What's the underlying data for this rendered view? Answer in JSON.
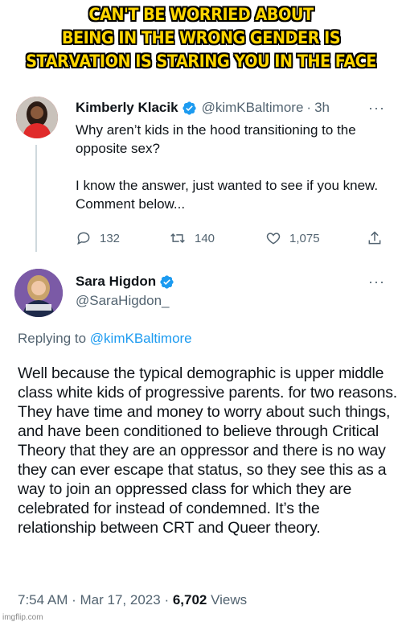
{
  "caption": {
    "line1": "CAN'T BE WORRIED ABOUT",
    "line2": "BEING IN THE WRONG GENDER IS",
    "line3": "STARVATION IS STARING YOU IN THE FACE"
  },
  "tweet1": {
    "name": "Kimberly Klacik",
    "handle": "@kimKBaltimore",
    "separator": "·",
    "time": "3h",
    "more": "···",
    "text": "Why aren’t kids in the hood transitioning to the opposite sex?\n\nI know the answer, just wanted to see if you knew. Comment below...",
    "actions": {
      "reply_count": "132",
      "retweet_count": "140",
      "like_count": "1,075"
    },
    "icons": [
      "reply-icon",
      "retweet-icon",
      "like-icon",
      "share-icon"
    ]
  },
  "tweet2": {
    "name": "Sara Higdon",
    "handle": "@SaraHigdon_",
    "more": "···",
    "replying_prefix": "Replying to",
    "replying_to": "@kimKBaltimore",
    "text": "Well because the typical demographic is upper middle class white kids of progressive parents. for two reasons. They have time and money to worry about such things, and have been conditioned to believe through Critical Theory that they are an oppressor and there is no way they can ever escape that status, so they see this as a way to join an oppressed class for which they are celebrated for instead of condemned. It’s the relationship between CRT and Queer theory.",
    "time": "7:54 AM",
    "dot1": "·",
    "date": "Mar 17, 2023",
    "dot2": "·",
    "views_count": "6,702",
    "views_label": "Views"
  },
  "watermark": "imgflip.com",
  "colors": {
    "caption_fill": "#ffd600",
    "verified_blue": "#1d9bf0",
    "secondary_text": "#536471",
    "avatar1_bg": "#d62a2a",
    "avatar2_bg": "#6a4a8e"
  }
}
